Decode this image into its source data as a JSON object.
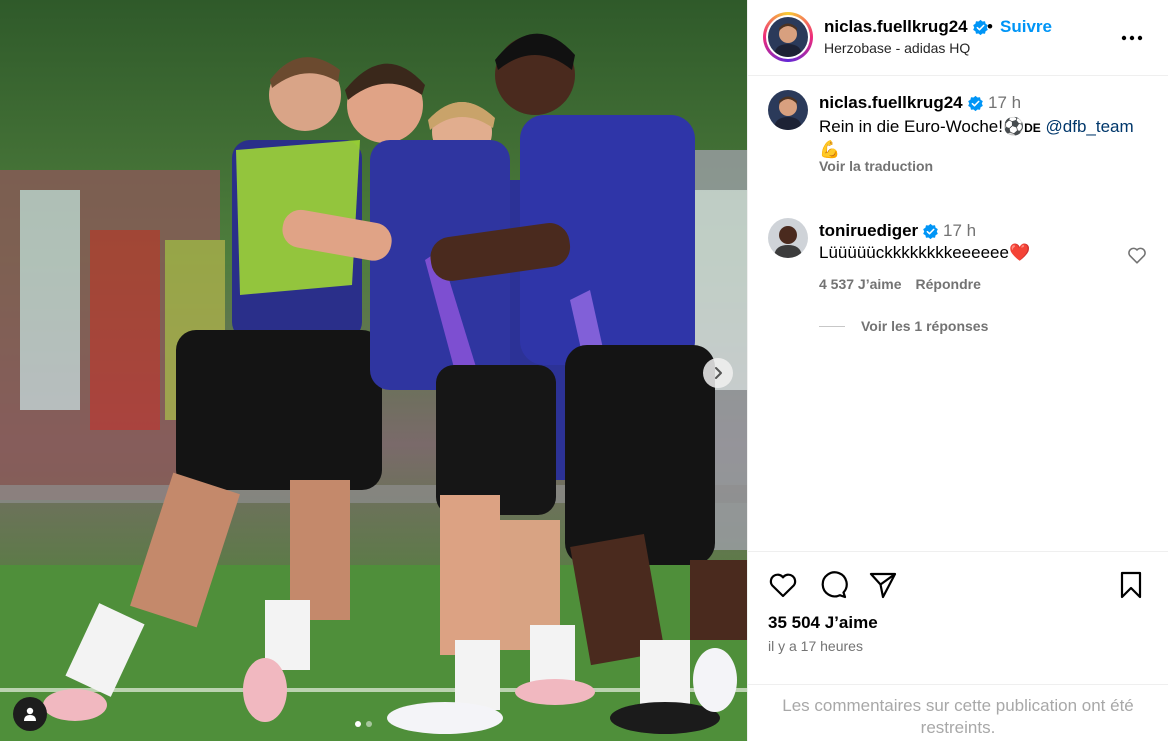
{
  "post": {
    "username": "niclas.fuellkrug24",
    "separator": "•",
    "follow_label": "Suivre",
    "location": "Herzobase - adidas HQ"
  },
  "caption": {
    "username": "niclas.fuellkrug24",
    "time": "17 h",
    "text": "Rein in die Euro-Woche!",
    "ball_emoji": "⚽",
    "flag_text": "DE",
    "mention": "@dfb_team",
    "muscle_emoji": "💪",
    "translate_label": "Voir la traduction"
  },
  "comment": {
    "username": "toniruediger",
    "time": "17 h",
    "text": "Lüüüüückkkkkkkkeeeeee",
    "heart_emoji": "❤️",
    "likes_label": "4 537 J’aime",
    "reply_label": "Répondre",
    "view_replies_label": "Voir les 1 réponses"
  },
  "actions": {
    "likes_label": "35 504 J’aime",
    "date_label": "il y a 17 heures"
  },
  "footer": {
    "restricted_text": "Les commentaires sur cette publication ont été restreints."
  },
  "media": {
    "carousel_index": 1,
    "carousel_count": 3
  },
  "icons": [
    "verified-badge-icon",
    "more-options-icon",
    "heart-icon",
    "comment-icon",
    "share-icon",
    "save-icon",
    "chevron-right-icon",
    "user-tag-icon"
  ],
  "colors": {
    "accent": "#0095f6",
    "muted": "#737373",
    "verified": "#0095f6"
  }
}
